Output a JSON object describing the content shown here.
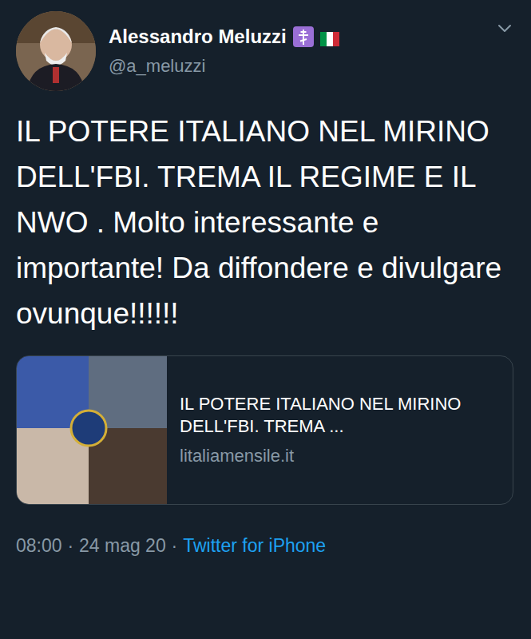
{
  "author": {
    "name": "Alessandro Meluzzi",
    "handle": "@a_meluzzi"
  },
  "tweet": {
    "text": "IL POTERE ITALIANO NEL MIRINO DELL'FBI. TREMA IL REGIME E IL NWO . Molto interessante e importante! Da diffondere e divulgare ovunque!!!!!!"
  },
  "link_card": {
    "title": "IL POTERE ITALIANO NEL MIRINO DELL'FBI. TREMA ...",
    "domain": "litaliamensile.it"
  },
  "meta": {
    "time": "08:00",
    "separator": "·",
    "date": "24 mag 20",
    "source": "Twitter for iPhone"
  }
}
